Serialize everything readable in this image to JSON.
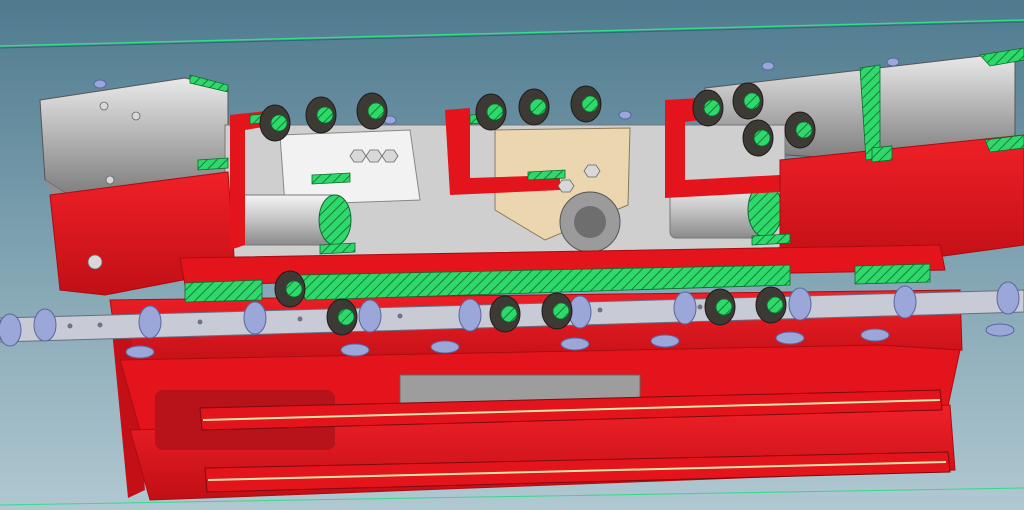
{
  "viewport": {
    "background_top": "#4f7a8e",
    "background_bottom": "#b0c8d1"
  },
  "colors": {
    "frame_red": "#e3141b",
    "frame_red_dark": "#a80d12",
    "section_hatch_green": "#2fd86a",
    "hatch_line": "#0d6a2c",
    "steel_gray": "#b9b9b9",
    "roller_dark": "#3d3a36",
    "roller_blue": "#9aa7d8",
    "plate_beige": "#ecd6b0",
    "guide_line_green": "#38d98a"
  },
  "model": {
    "view": "cross-section",
    "components": [
      "frame-red",
      "section-hatch-green",
      "conveyor-chain",
      "rollers-dark",
      "rollers-blue",
      "bearing-plates",
      "cylinders",
      "side-channels"
    ]
  }
}
